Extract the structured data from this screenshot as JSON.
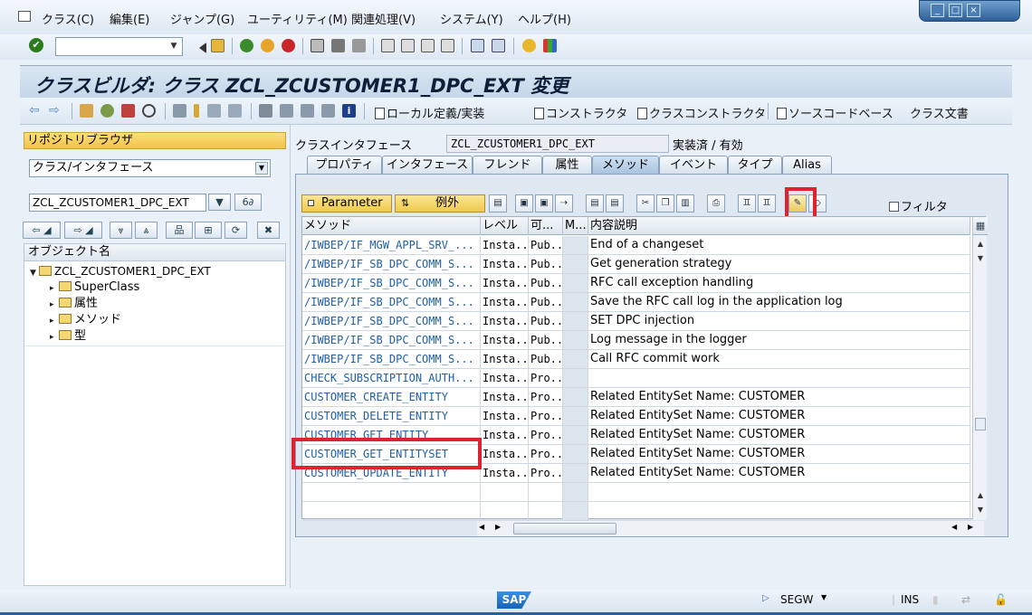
{
  "menubar": {
    "items": [
      "クラス(C)",
      "編集(E)",
      "ジャンプ(G)",
      "ユーティリティ(M)",
      "関連処理(V)",
      "システム(Y)",
      "ヘルプ(H)"
    ],
    "window_controls": [
      "minimize-icon",
      "maximize-icon",
      "close-icon"
    ]
  },
  "stdbar": {
    "command_value": "",
    "ok_icon": "check-icon"
  },
  "title": "クラスビルダ: クラス ZCL_ZCUSTOMER1_DPC_EXT 変更",
  "appbar": {
    "buttons": [
      "ローカル定義/実装",
      "コンストラクタ",
      "クラスコンストラクタ",
      "ソースコードベース",
      "クラス文書"
    ]
  },
  "left": {
    "repo_browser": "リポジトリブラウザ",
    "object_type": "クラス/インタフェース",
    "object_name": "ZCL_ZCUSTOMER1_DPC_EXT",
    "tree_header": "オブジェクト名",
    "tree_root": "ZCL_ZCUSTOMER1_DPC_EXT",
    "tree_children": [
      "SuperClass",
      "属性",
      "メソッド",
      "型"
    ]
  },
  "right": {
    "class_interface_label": "クラスインタフェース",
    "class_name": "ZCL_ZCUSTOMER1_DPC_EXT",
    "status": "実装済 / 有効",
    "tabs": [
      "プロパティ",
      "インタフェース",
      "フレンド",
      "属性",
      "メソッド",
      "イベント",
      "タイプ",
      "Alias"
    ],
    "active_tab": "メソッド",
    "parameter_button": "Parameter",
    "exception_button": "例外",
    "filter_label": "フィルタ",
    "columns": [
      "メソッド",
      "レベル",
      "可...",
      "M...",
      "内容説明"
    ],
    "rows": [
      {
        "method": "/IWBEP/IF_MGW_APPL_SRV_...",
        "level": "Insta...",
        "vis": "Pub...",
        "desc": "End of a changeset"
      },
      {
        "method": "/IWBEP/IF_SB_DPC_COMM_S...",
        "level": "Insta...",
        "vis": "Pub...",
        "desc": "Get generation strategy"
      },
      {
        "method": "/IWBEP/IF_SB_DPC_COMM_S...",
        "level": "Insta...",
        "vis": "Pub...",
        "desc": "RFC call exception handling"
      },
      {
        "method": "/IWBEP/IF_SB_DPC_COMM_S...",
        "level": "Insta...",
        "vis": "Pub...",
        "desc": "Save the RFC call log in the application log"
      },
      {
        "method": "/IWBEP/IF_SB_DPC_COMM_S...",
        "level": "Insta...",
        "vis": "Pub...",
        "desc": "SET DPC injection"
      },
      {
        "method": "/IWBEP/IF_SB_DPC_COMM_S...",
        "level": "Insta...",
        "vis": "Pub...",
        "desc": "Log message in the logger"
      },
      {
        "method": "/IWBEP/IF_SB_DPC_COMM_S...",
        "level": "Insta...",
        "vis": "Pub...",
        "desc": "Call RFC commit work"
      },
      {
        "method": "CHECK_SUBSCRIPTION_AUTH...",
        "level": "Insta...",
        "vis": "Pro...",
        "desc": ""
      },
      {
        "method": "CUSTOMER_CREATE_ENTITY",
        "level": "Insta...",
        "vis": "Pro...",
        "desc": "Related EntitySet Name: CUSTOMER"
      },
      {
        "method": "CUSTOMER_DELETE_ENTITY",
        "level": "Insta...",
        "vis": "Pro...",
        "desc": "Related EntitySet Name: CUSTOMER"
      },
      {
        "method": "CUSTOMER_GET_ENTITY",
        "level": "Insta...",
        "vis": "Pro...",
        "desc": "Related EntitySet Name: CUSTOMER"
      },
      {
        "method": "CUSTOMER_GET_ENTITYSET",
        "level": "Insta...",
        "vis": "Pro...",
        "desc": "Related EntitySet Name: CUSTOMER"
      },
      {
        "method": "CUSTOMER_UPDATE_ENTITY",
        "level": "Insta...",
        "vis": "Pro...",
        "desc": "Related EntitySet Name: CUSTOMER"
      }
    ]
  },
  "status": {
    "sap_logo": "SAP",
    "transaction": "SEGW",
    "mode": "INS"
  },
  "colors": {
    "highlight": "#e0212f",
    "link": "#1f5fa8",
    "title_bg": "#c4d6e8"
  }
}
